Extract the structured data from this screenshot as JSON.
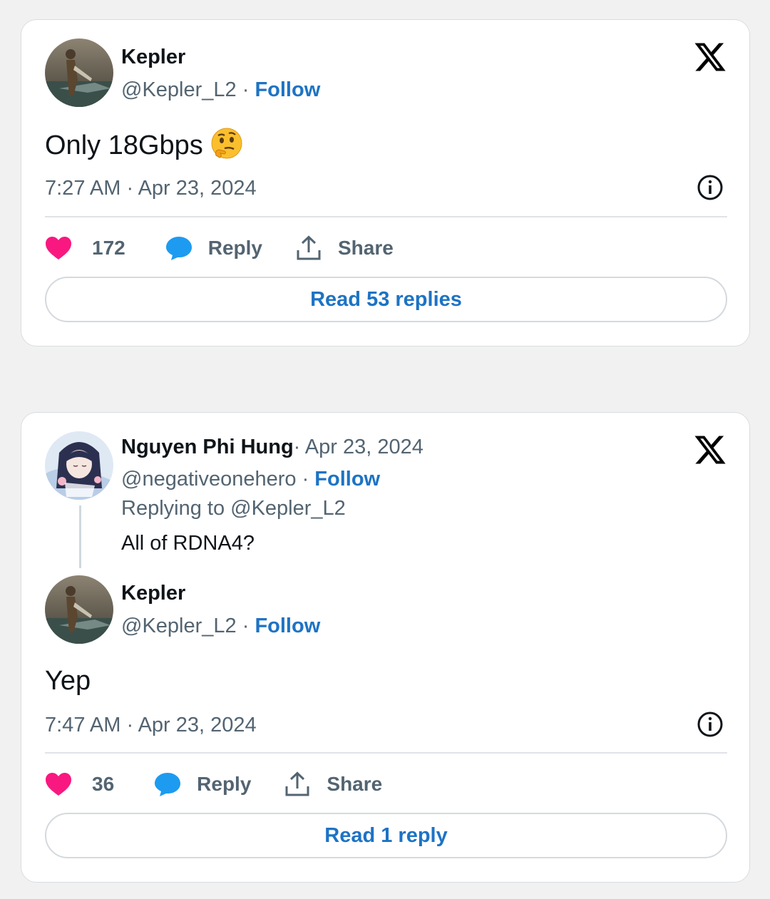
{
  "colors": {
    "link": "#1d73c4",
    "heart": "#f91880",
    "reply_bubble": "#1d9bf0",
    "muted": "#536471",
    "text": "#0f1419"
  },
  "tweets": [
    {
      "author": {
        "name": "Kepler",
        "handle": "@Kepler_L2",
        "follow_label": "Follow",
        "avatar_icon": "statue-avatar"
      },
      "platform_icon": "x-logo-icon",
      "text": "Only 18Gbps",
      "emoji": "thinking-face-emoji",
      "timestamp": "7:27 AM · Apr 23, 2024",
      "likes": "172",
      "reply_label": "Reply",
      "share_label": "Share",
      "read_replies_label": "Read 53 replies"
    },
    {
      "parent": {
        "author": {
          "name": "Nguyen Phi Hung",
          "handle": "@negativeonehero",
          "follow_label": "Follow",
          "avatar_icon": "anime-girl-avatar"
        },
        "date": "· Apr 23, 2024",
        "replying_to": "Replying to @Kepler_L2",
        "text": "All of RDNA4?"
      },
      "author": {
        "name": "Kepler",
        "handle": "@Kepler_L2",
        "follow_label": "Follow",
        "avatar_icon": "statue-avatar"
      },
      "platform_icon": "x-logo-icon",
      "text": "Yep",
      "timestamp": "7:47 AM · Apr 23, 2024",
      "likes": "36",
      "reply_label": "Reply",
      "share_label": "Share",
      "read_replies_label": "Read 1 reply"
    }
  ]
}
